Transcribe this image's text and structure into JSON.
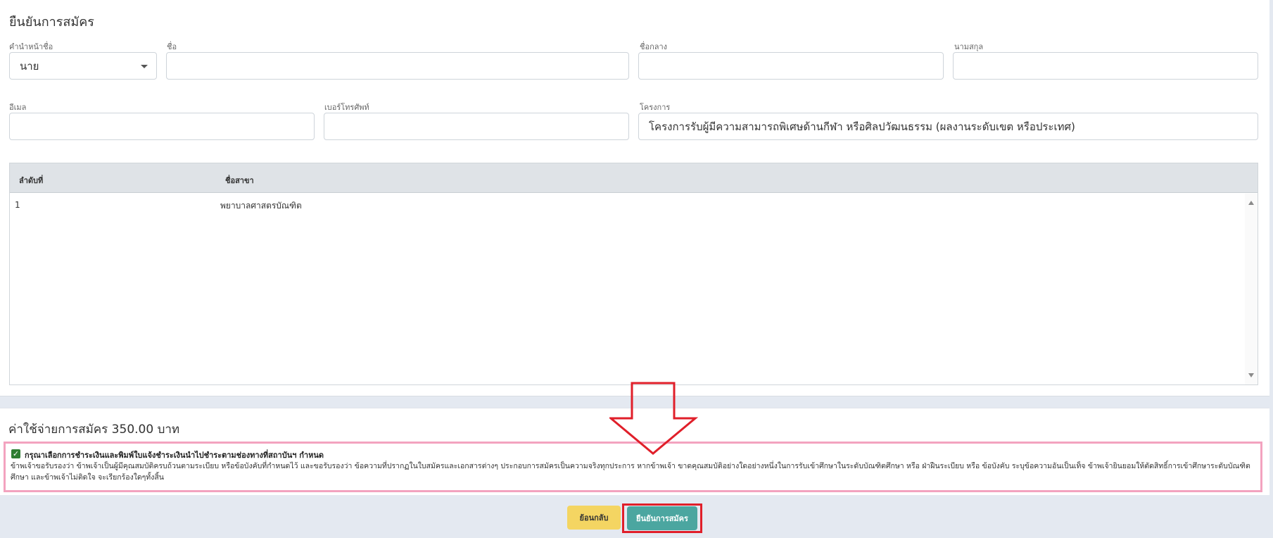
{
  "page": {
    "title": "ยืนยันการสมัคร"
  },
  "form": {
    "prefix": {
      "label": "คำนำหน้าชื่อ",
      "value": "นาย"
    },
    "first_name": {
      "label": "ชื่อ",
      "value": ""
    },
    "middle_name": {
      "label": "ชื่อกลาง",
      "value": ""
    },
    "last_name": {
      "label": "นามสกุล",
      "value": ""
    },
    "email": {
      "label": "อีเมล",
      "value": ""
    },
    "phone": {
      "label": "เบอร์โทรศัพท์",
      "value": ""
    },
    "project": {
      "label": "โครงการ",
      "value": "โครงการรับผู้มีความสามารถพิเศษด้านกีฬา หรือศิลปวัฒนธรรม (ผลงานระดับเขต หรือประเทศ)"
    }
  },
  "table": {
    "headers": [
      "ลำดับที่",
      "ชื่อสาขา"
    ],
    "rows": [
      [
        "1",
        "พยาบาลศาสตรบัณฑิต"
      ]
    ]
  },
  "fee": {
    "title": "ค่าใช้จ่ายการสมัคร 350.00 บาท"
  },
  "consent": {
    "checked": true,
    "heading": "กรุณาเลือกการชำระเงินและพิมพ์ใบแจ้งชำระเงินนำไปชำระตามช่องทางที่สถาบันฯ กำหนด",
    "text": "ข้าพเจ้าขอรับรองว่า ข้าพเจ้าเป็นผู้มีคุณสมบัติครบถ้วนตามระเบียบ หรือข้อบังคับที่กำหนดไว้ และขอรับรองว่า ข้อความที่ปรากฏในใบสมัครและเอกสารต่างๆ ประกอบการสมัครเป็นความจริงทุกประการ หากข้าพเจ้า ขาดคุณสมบัติอย่างใดอย่างหนึ่งในการรับเข้าศึกษาในระดับบัณฑิตศึกษา หรือ ฝ่าฝืนระเบียบ หรือ ข้อบังคับ ระบุข้อความอันเป็นเท็จ ข้าพเจ้ายินยอมให้ตัดสิทธิ์การเข้าศึกษาระดับบัณฑิตศึกษา และข้าพเจ้าไม่ติดใจ จะเรียกร้องใดๆทั้งสิ้น"
  },
  "buttons": {
    "back": "ย้อนกลับ",
    "confirm": "ยืนยันการสมัคร"
  },
  "annotation": {
    "arrow_color": "#e01f2a",
    "highlight_color": "#f3a3bf"
  }
}
